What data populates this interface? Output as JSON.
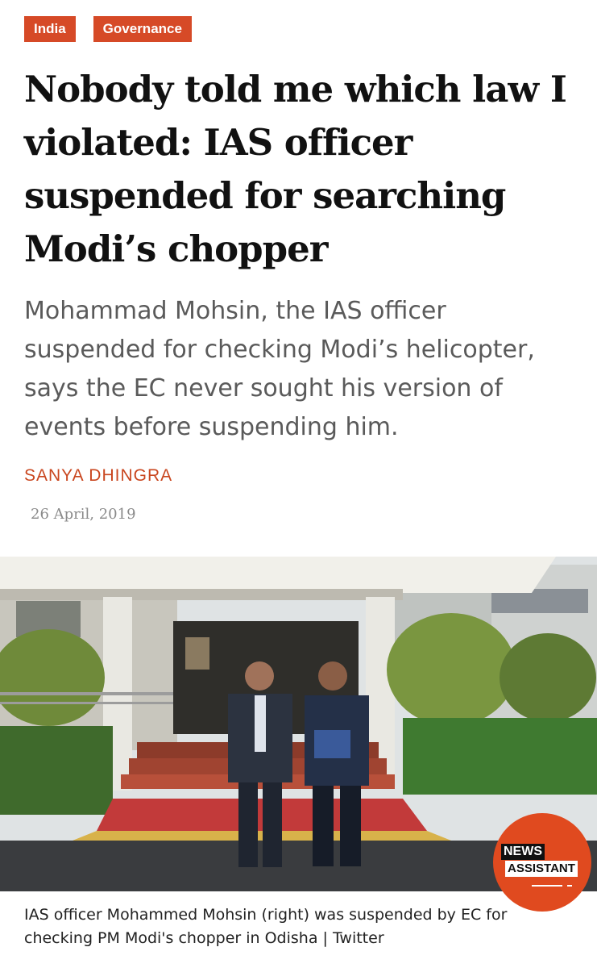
{
  "tags": [
    "India",
    "Governance"
  ],
  "headline": "Nobody told me which law I violated: IAS officer suspended for searching Modi’s chopper",
  "standfirst": "Mohammad Mohsin, the IAS officer suspended for checking Modi’s helicopter, says the EC never sought his version of events before suspending him.",
  "author": "SANYA DHINGRA",
  "date": "26 April, 2019",
  "caption": "IAS officer Mohammed Mohsin (right) was suspended by EC for checking PM Modi's chopper in Odisha | Twitter",
  "badge": {
    "line1": "NEWS",
    "line2": "ASSISTANT"
  },
  "colors": {
    "accent": "#d64a27",
    "author": "#c9461f",
    "badge": "#e04a1f"
  }
}
